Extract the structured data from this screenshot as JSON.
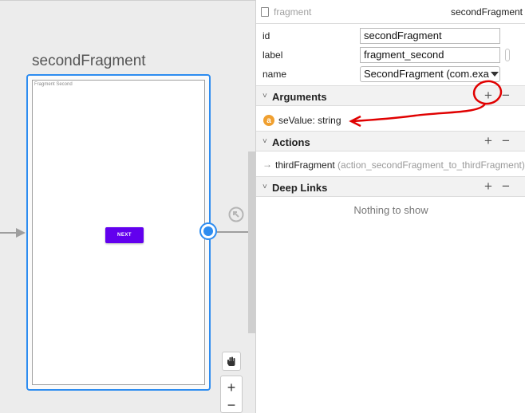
{
  "canvas": {
    "destination_title": "secondFragment",
    "frame_inner_label": "Fragment Second",
    "next_button_label": "NEXT",
    "pan_glyph": "✋",
    "zoom_in": "+",
    "zoom_out": "−"
  },
  "panel": {
    "header": {
      "type": "fragment",
      "name": "secondFragment"
    },
    "attributes": {
      "id_label": "id",
      "id_value": "secondFragment",
      "label_label": "label",
      "label_value": "fragment_second",
      "name_label": "name",
      "name_value": "SecondFragment (com.exa"
    },
    "arguments": {
      "title": "Arguments",
      "caret": "˅",
      "plus": "+",
      "minus": "−",
      "item": {
        "badge": "a",
        "text": "seValue: string"
      }
    },
    "actions": {
      "title": "Actions",
      "caret": "˅",
      "plus": "+",
      "minus": "−",
      "item": {
        "arrow": "→",
        "name": "thirdFragment",
        "detail": " (action_secondFragment_to_thirdFragment)"
      }
    },
    "deep_links": {
      "title": "Deep Links",
      "caret": "˅",
      "plus": "+",
      "minus": "−",
      "empty_text": "Nothing to show"
    }
  },
  "colors": {
    "selection_blue": "#2d8cf0",
    "button_purple": "#6200ee",
    "annotation_red": "#e00000",
    "argument_badge": "#f0a030"
  },
  "icons": [
    "fragment-icon",
    "nav-arrow-icon",
    "hand-icon",
    "argument-badge-icon",
    "action-arrow-icon",
    "caret-down-icon"
  ]
}
